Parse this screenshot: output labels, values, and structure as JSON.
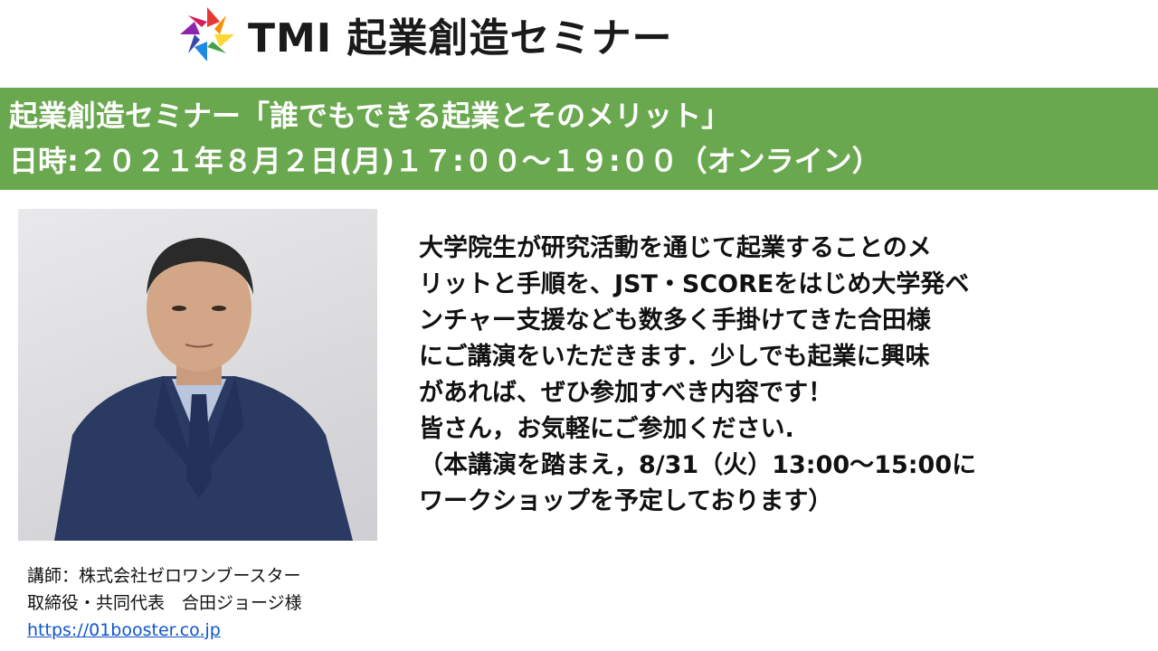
{
  "header": {
    "title": "TMI 起業創造セミナー",
    "logo_icon": "aperture-logo-icon"
  },
  "banner": {
    "line1": "起業創造セミナー「誰でもできる起業とそのメリット」",
    "line2": "日時:２０２１年８月２日(月)１７:００～１９:００（オンライン）",
    "color": "#6aa84f"
  },
  "photo": {
    "icon": "speaker-portrait-photo"
  },
  "description": {
    "lines": [
      "大学院生が研究活動を通じて起業することのメ",
      "リットと手順を、JST・SCOREをはじめ大学発ベ",
      "ンチャー支援なども数多く手掛けてきた合田様",
      "にご講演をいただきます．少しでも起業に興味",
      "があれば、ぜひ参加すべき内容です！",
      "皆さん，お気軽にご参加ください.",
      "（本講演を踏まえ，8/31（火）13:00～15:00に",
      "ワークショップを予定しております）"
    ]
  },
  "speaker": {
    "line1": "講師：株式会社ゼロワンブースター",
    "line2": "取締役・共同代表　合田ジョージ様",
    "link": "https://01booster.co.jp"
  }
}
